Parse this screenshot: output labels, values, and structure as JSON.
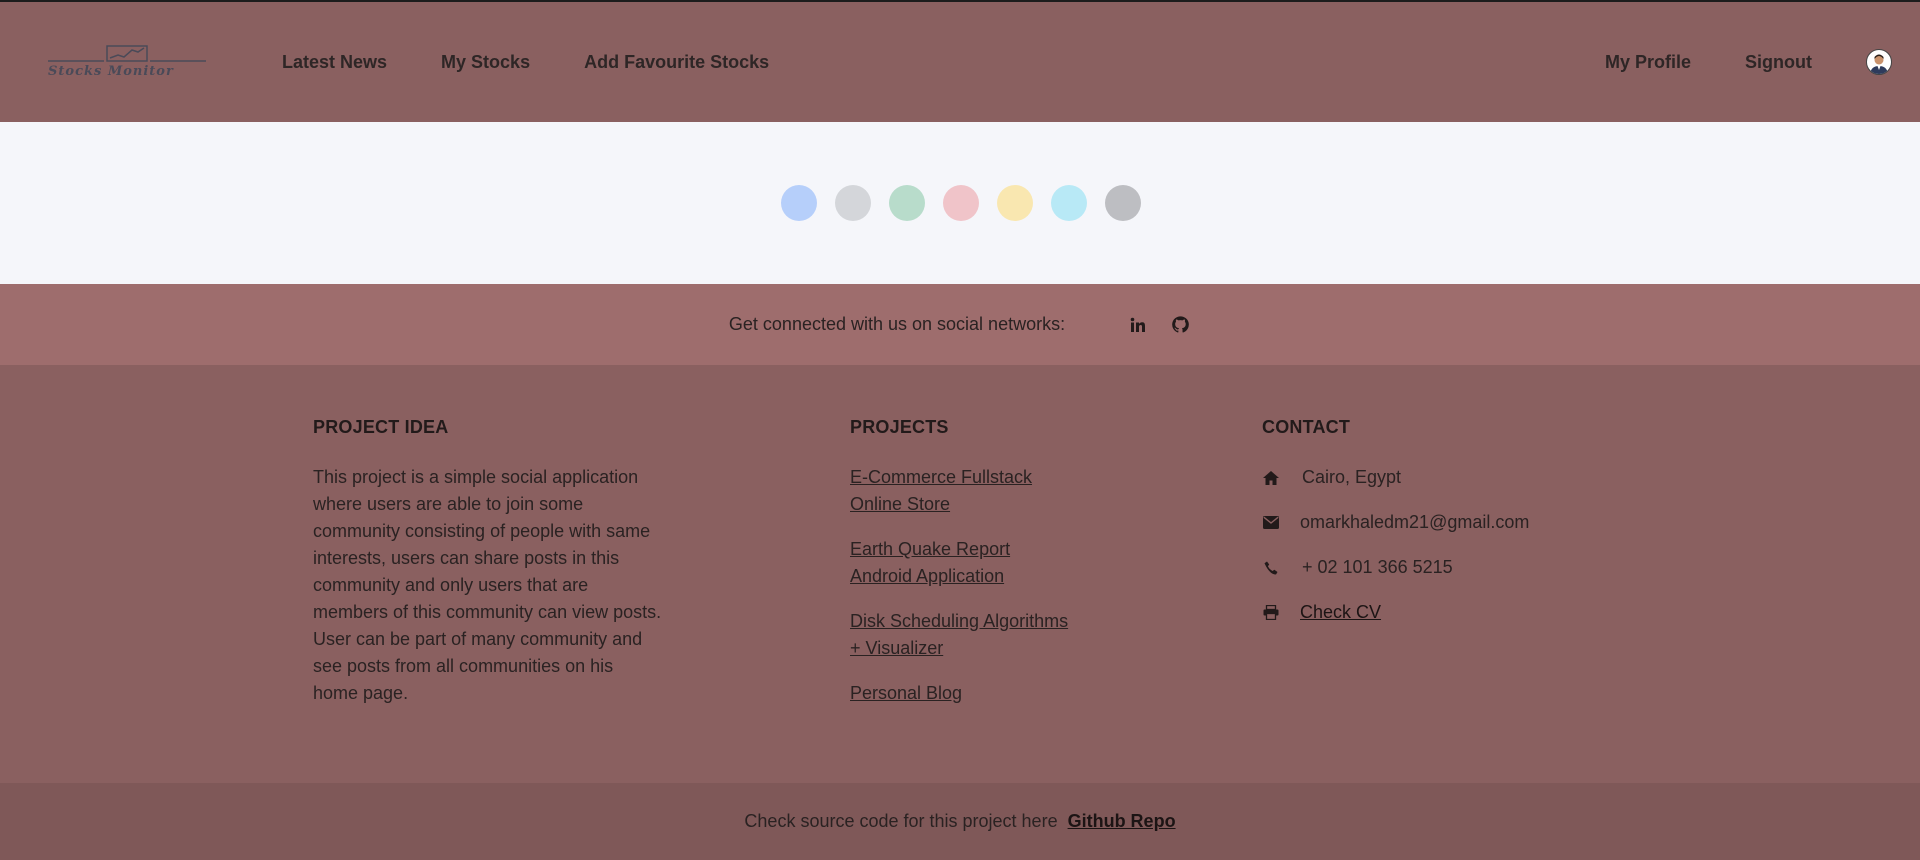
{
  "brand": {
    "logo_text": "Stocks Monitor"
  },
  "nav": {
    "left": [
      {
        "label": "Latest News"
      },
      {
        "label": "My Stocks"
      },
      {
        "label": "Add Favourite Stocks"
      }
    ],
    "right": [
      {
        "label": "My Profile"
      },
      {
        "label": "Signout"
      }
    ]
  },
  "loader": {
    "dots": [
      "#b6cffa",
      "#d4d6da",
      "#b8dccb",
      "#f0c4c9",
      "#f9e7b0",
      "#b8e9f6",
      "#bdbec2"
    ]
  },
  "social": {
    "text": "Get connected with us on social networks:",
    "icons": [
      "linkedin-icon",
      "github-icon"
    ]
  },
  "footer": {
    "project_idea": {
      "title": "PROJECT IDEA",
      "text": "This project is a simple social application where users are able to join some community consisting of people with same interests, users can share posts in this community and only users that are members of this community can view posts.",
      "text2": "User can be part of many community and see posts from all communities on his home page."
    },
    "projects": {
      "title": "PROJECTS",
      "links": [
        {
          "label": "E-Commerce Fullstack Online Store"
        },
        {
          "label": "Earth Quake Report Android Application"
        },
        {
          "label": "Disk Scheduling Algorithms + Visualizer"
        },
        {
          "label": "Personal Blog"
        }
      ]
    },
    "contact": {
      "title": "CONTACT",
      "address": "Cairo, Egypt",
      "email": "omarkhaledm21@gmail.com",
      "phone": "+ 02 101 366 5215",
      "cv_label": "Check CV"
    }
  },
  "bottom": {
    "text": "Check source code for this project here",
    "repo_label": "Github Repo"
  }
}
